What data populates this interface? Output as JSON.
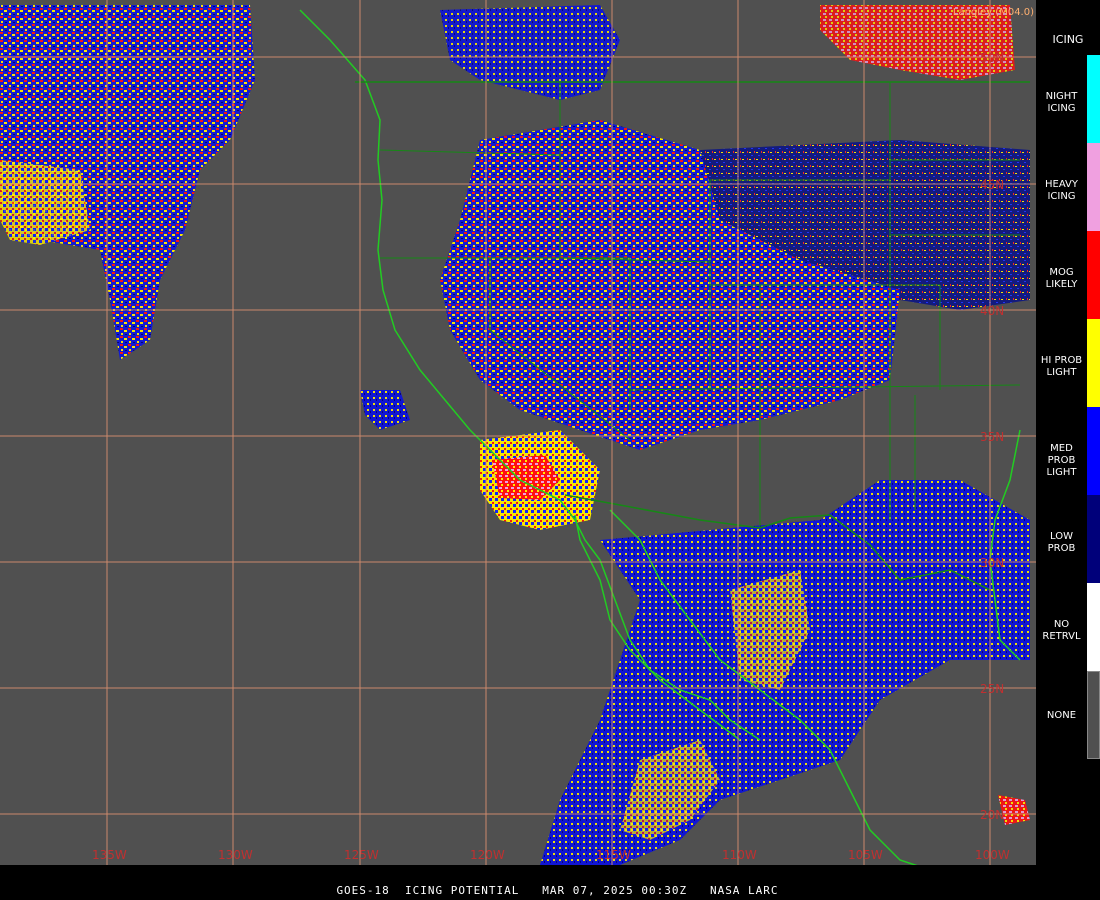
{
  "map": {
    "credit": "Langley (M04.0)",
    "longitude_labels": [
      "135W",
      "130W",
      "125W",
      "120W",
      "115W",
      "110W",
      "105W",
      "100W"
    ],
    "latitude_labels": [
      "50N",
      "45N",
      "40N",
      "35N",
      "30N",
      "25N",
      "20N"
    ],
    "gridline_color": "#d89070",
    "background_color": "#505050",
    "coastline_color": "#22cc22"
  },
  "legend": {
    "title": "ICING",
    "categories": [
      {
        "label": "NIGHT ICING",
        "color": "#00ffff"
      },
      {
        "label": "HEAVY ICING",
        "color": "#f0a0e0"
      },
      {
        "label": "MOG LIKELY",
        "color": "#ff0000"
      },
      {
        "label": "HI PROB LIGHT",
        "color": "#ffff00"
      },
      {
        "label": "MED PROB LIGHT",
        "color": "#0000ff"
      },
      {
        "label": "LOW PROB",
        "color": "#00007a"
      },
      {
        "label": "NO RETRVL",
        "color": "#ffffff"
      },
      {
        "label": "NONE",
        "color": "#505050"
      }
    ]
  },
  "footer": {
    "title": "GOES-18  ICING POTENTIAL   MAR 07, 2025 00:30Z   NASA LARC"
  }
}
